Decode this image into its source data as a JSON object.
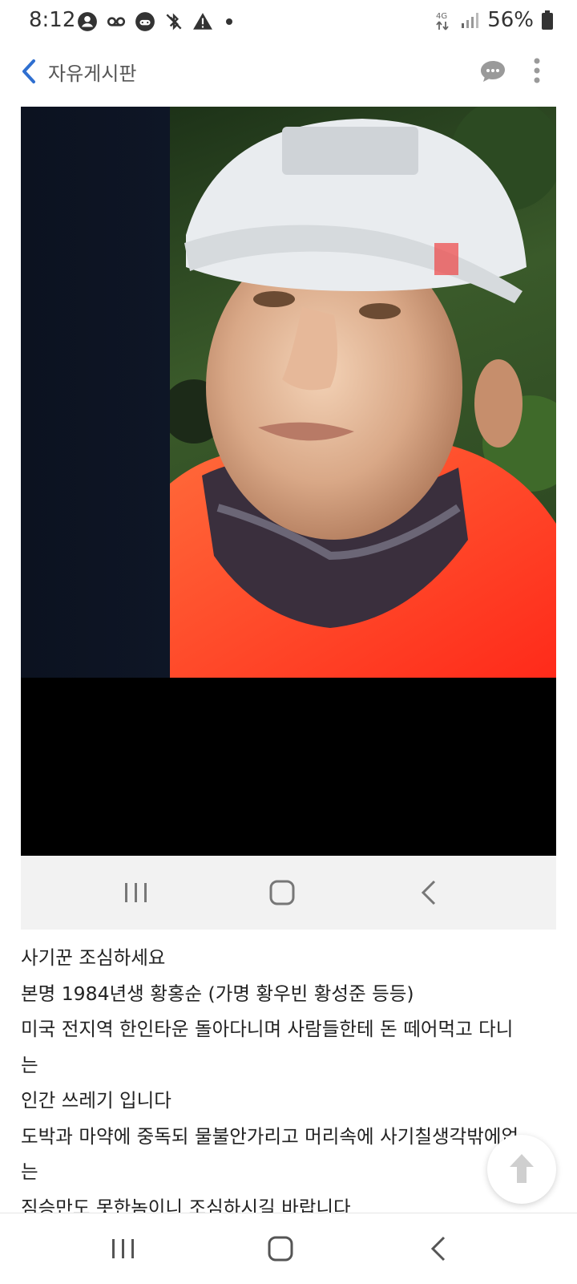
{
  "status_bar": {
    "time": "8:12",
    "battery": "56%",
    "icons": [
      "account-icon",
      "voicemail-icon",
      "game-icon",
      "bluetooth-off-icon",
      "warning-icon",
      "dot-icon",
      "vibrate-icon",
      "signal-icon",
      "battery-icon"
    ]
  },
  "header": {
    "title": "자유게시판",
    "back_icon": "chevron-left-icon",
    "comment_icon": "chat-bubble-icon",
    "more_icon": "more-vertical-icon"
  },
  "post": {
    "image_alt": "photo",
    "embedded_nav_icons": [
      "recent-apps-icon",
      "home-icon",
      "back-icon"
    ],
    "lines": [
      "사기꾼 조심하세요",
      "본명 1984년생 황홍순 (가명 황우빈 황성준 등등)",
      "미국 전지역 한인타운 돌아다니며 사람들한테 돈 떼어먹고 다니",
      "는",
      "인간 쓰레기 입니다",
      "도박과 마약에 중독되 물불안가리고 머리속에 사기칠생각밖에없",
      "는",
      "짐승만도 못한놈이니 조심하시길 바랍니다"
    ]
  },
  "scroll_top_icon": "arrow-up-icon",
  "system_nav": [
    "recent-apps-icon",
    "home-icon",
    "back-icon"
  ],
  "colors": {
    "accent": "#2f6fd0",
    "text": "#222222"
  }
}
